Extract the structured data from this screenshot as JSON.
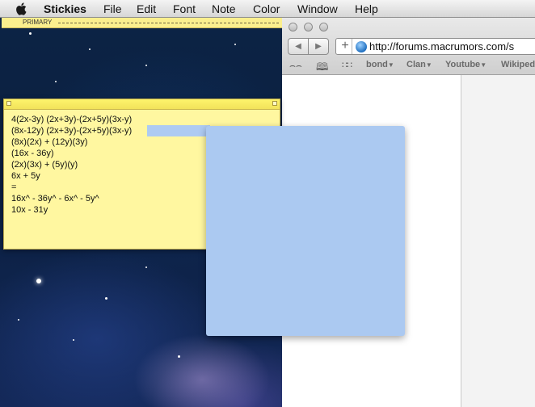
{
  "menubar": {
    "app_name": "Stickies",
    "items": [
      "File",
      "Edit",
      "Font",
      "Note",
      "Color",
      "Window",
      "Help"
    ]
  },
  "primary_stickie": {
    "title": "PRIMARY"
  },
  "stickie": {
    "lines": [
      "4(2x-3y) (2x+3y)-(2x+5y)(3x-y)",
      "(8x-12y) (2x+3y)-(2x+5y)(3x-y)",
      "(8x)(2x) + (12y)(3y)",
      "(16x - 36y)",
      "(2x)(3x) + (5y)(y)",
      "6x + 5y",
      "=",
      "16x^ - 36y^ - 6x^ - 5y^",
      "10x - 31y"
    ],
    "color": "#fff7a0"
  },
  "browser": {
    "url": "http://forums.macrumors.com/s",
    "add_label": "+",
    "back_label": "◀",
    "forward_label": "▶",
    "bookmarks": [
      {
        "label": "bond",
        "has_menu": true
      },
      {
        "label": "Clan",
        "has_menu": true
      },
      {
        "label": "Youtube",
        "has_menu": true
      },
      {
        "label": "Wikiped",
        "has_menu": false
      }
    ],
    "bookmark_icons": [
      "reading-list-icon",
      "bookmarks-book-icon",
      "top-sites-grid-icon"
    ]
  },
  "drag_panel": {
    "color": "#abc9f1"
  },
  "colors": {
    "menubar": "#e6e6e6",
    "stickie_yellow": "#fff7a0",
    "selection_blue": "#aecbf2"
  }
}
